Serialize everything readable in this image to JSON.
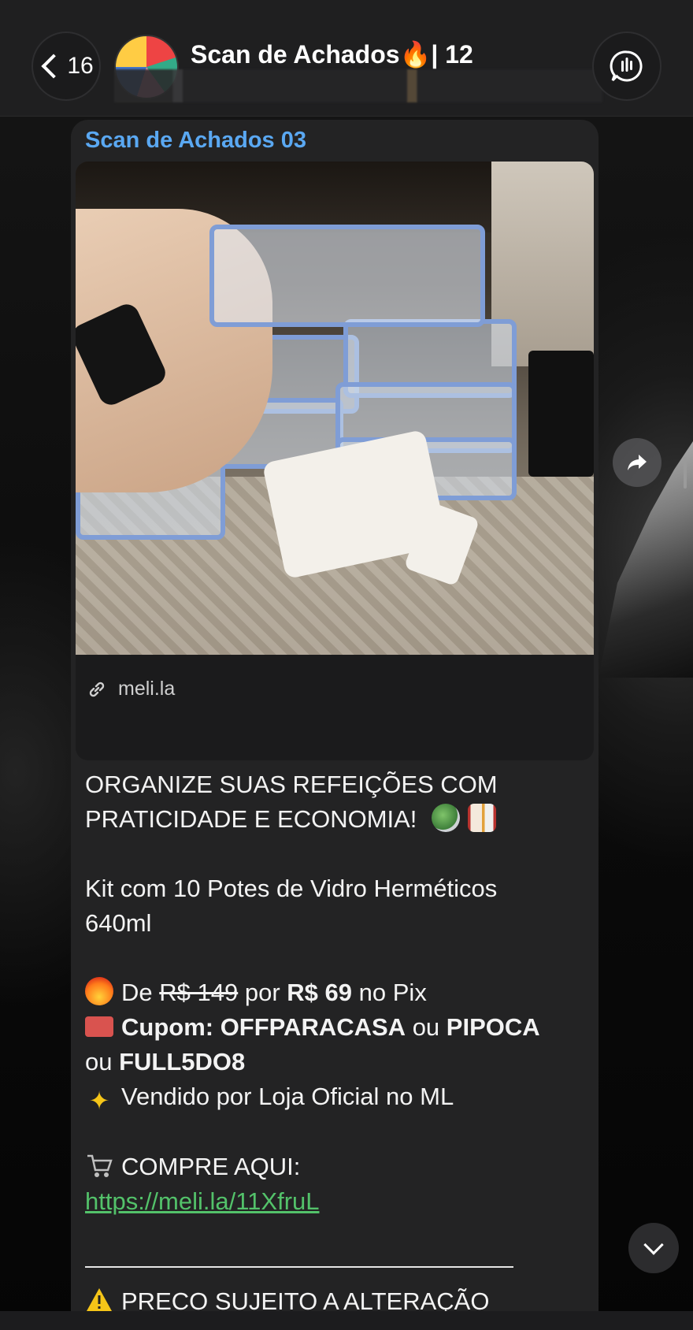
{
  "header": {
    "back_count": "16",
    "title": "Scan de Achados🔥| 12",
    "icons": {
      "back": "chevron-left-icon",
      "call": "voice-chat-icon"
    }
  },
  "message": {
    "sender": "Scan de Achados 03",
    "link_preview": {
      "domain": "meli.la",
      "icon": "link-icon"
    },
    "headline_1": "ORGANIZE SUAS REFEIÇÕES COM",
    "headline_2": "PRATICIDADE E ECONOMIA!",
    "product_1": "Kit com 10 Potes de Vidro Herméticos",
    "product_2": "640ml",
    "price_de": "De",
    "price_old": "R$ 149",
    "price_por": "por",
    "price_new": "R$ 69",
    "price_suffix": "no Pix",
    "coupon_label": "Cupom: OFFPARACASA",
    "coupon_or_1": "ou",
    "coupon_2": "PIPOCA",
    "coupon_or_2": "ou",
    "coupon_3": "FULL5DO8",
    "seller": "Vendido por Loja Oficial no ML",
    "buy_label": "COMPRE AQUI:",
    "buy_link": "https://meli.la/11XfruL",
    "warning": "PRECO SUJEITO A ALTERAÇÃO"
  },
  "colors": {
    "sender": "#5aa8f2",
    "link": "#53c26a",
    "bubble": "#232324"
  }
}
